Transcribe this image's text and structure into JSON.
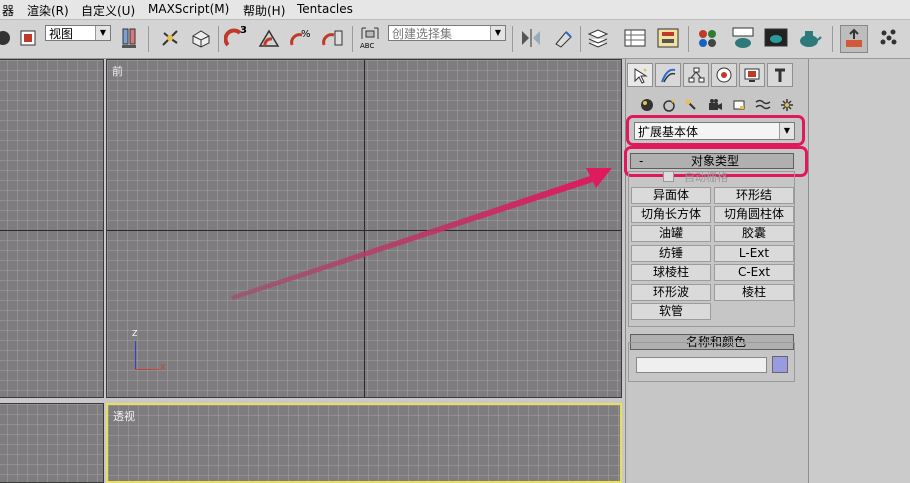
{
  "menubar": {
    "items": [
      "器",
      "渲染(R)",
      "自定义(U)",
      "MAXScript(M)",
      "帮助(H)",
      "Tentacles"
    ]
  },
  "toolbar": {
    "view_combo": "视图",
    "superscript_3": "3",
    "named_selection_placeholder": "创建选择集",
    "abc_label": "ABC"
  },
  "viewports": {
    "front_label": "前",
    "persp_label": "透视",
    "axis_z": "Z",
    "axis_x": "X"
  },
  "cmdpanel": {
    "category": "扩展基本体",
    "rollout_object_type": {
      "title": "对象类型",
      "minus": "-",
      "autogrid": "自动栅格",
      "buttons": [
        "异面体",
        "环形结",
        "切角长方体",
        "切角圆柱体",
        "油罐",
        "胶囊",
        "纺锤",
        "L-Ext",
        "球棱柱",
        "C-Ext",
        "环形波",
        "棱柱",
        "软管"
      ]
    },
    "rollout_name_color": {
      "title": "名称和颜色",
      "minus": "-",
      "name_value": "",
      "swatch_color": "#9a9ae0"
    }
  },
  "colors": {
    "highlight": "#e0185c",
    "arrow": "#d81b60",
    "active_viewport_border": "#e8e05a"
  }
}
